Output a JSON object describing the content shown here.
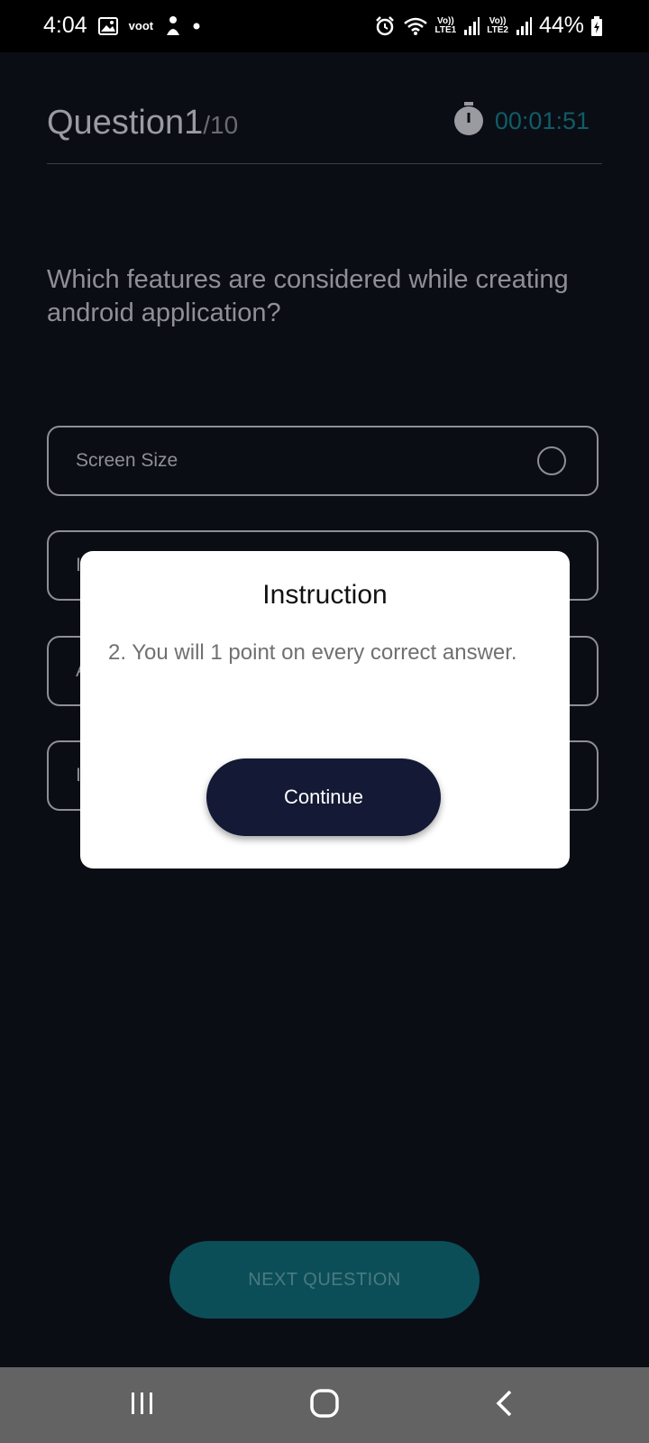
{
  "status_bar": {
    "time": "4:04",
    "notif_voot": "voot",
    "net1_top": "Vo))",
    "net1_bottom": "LTE1",
    "net2_top": "Vo))",
    "net2_bottom": "LTE2",
    "battery": "44%"
  },
  "quiz": {
    "question_label": "Question1",
    "question_total": "/10",
    "timer": "00:01:51",
    "question_text": "Which features are considered while creating android application?",
    "options": [
      {
        "label": "Screen Size"
      },
      {
        "label": "I"
      },
      {
        "label": "A"
      },
      {
        "label": "I"
      }
    ],
    "next_label": "NEXT QUESTION"
  },
  "dialog": {
    "title": "Instruction",
    "body": "2. You will 1 point on every correct answer.",
    "continue_label": "Continue"
  },
  "colors": {
    "background": "#0b0d15",
    "timer": "#0f5d68",
    "next_button": "#0b4e58",
    "continue_button": "#141a35"
  }
}
